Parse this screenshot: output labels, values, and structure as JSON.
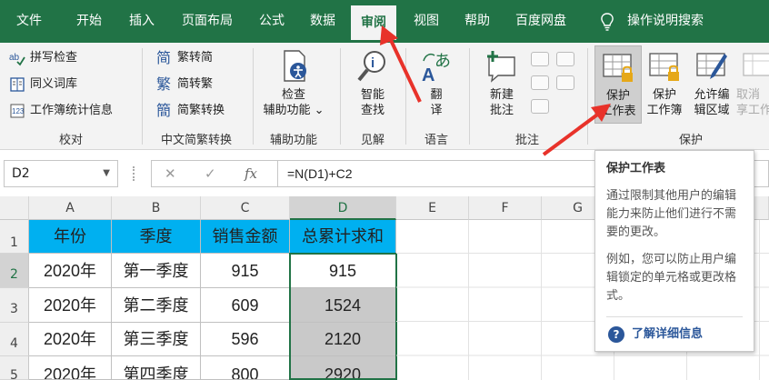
{
  "menu": {
    "tabs": [
      "文件",
      "开始",
      "插入",
      "页面布局",
      "公式",
      "数据",
      "审阅",
      "视图",
      "帮助",
      "百度网盘",
      "操作说明搜索"
    ],
    "active": "审阅"
  },
  "ribbon": {
    "proofing": {
      "items": [
        "拼写检查",
        "同义词库",
        "工作簿统计信息"
      ],
      "label": "校对"
    },
    "chinese": {
      "items": [
        "繁转简",
        "简转繁",
        "简繁转换"
      ],
      "label": "中文简繁转换"
    },
    "accessibility": {
      "button_line1": "检查",
      "button_line2": "辅助功能 ⌄",
      "label": "辅助功能"
    },
    "insights": {
      "button_line1": "智能",
      "button_line2": "查找",
      "label": "见解"
    },
    "language": {
      "button_line1": "翻",
      "button_line2": "译",
      "label": "语言"
    },
    "comments": {
      "button_line1": "新建",
      "button_line2": "批注",
      "label": "批注"
    },
    "protect": {
      "sheet_line1": "保护",
      "sheet_line2": "工作表",
      "workbook_line1": "保护",
      "workbook_line2": "工作簿",
      "ranges_line1": "允许编",
      "ranges_line2": "辑区域",
      "unshare_line1": "取消",
      "unshare_line2": "享工作",
      "label": "保护"
    }
  },
  "formula_bar": {
    "name_box": "D2",
    "formula": "=N(D1)+C2",
    "fx": "fx"
  },
  "columns": [
    "A",
    "B",
    "C",
    "D",
    "E",
    "F",
    "G"
  ],
  "rows": [
    "1",
    "2",
    "3",
    "4",
    "5"
  ],
  "table": {
    "headers": [
      "年份",
      "季度",
      "销售金额",
      "总累计求和"
    ],
    "data": [
      [
        "2020年",
        "第一季度",
        "915",
        "915"
      ],
      [
        "2020年",
        "第二季度",
        "609",
        "1524"
      ],
      [
        "2020年",
        "第三季度",
        "596",
        "2120"
      ],
      [
        "2020年",
        "第四季度",
        "800",
        "2920"
      ]
    ]
  },
  "tooltip": {
    "title": "保护工作表",
    "para1": "通过限制其他用户的编辑能力来防止他们进行不需要的更改。",
    "para2": "例如，您可以防止用户编辑锁定的单元格或更改格式。",
    "link": "了解详细信息"
  },
  "colors": {
    "excel_green": "#217346",
    "header_fill": "#00b0f0",
    "gray_fill": "#c9c9c9",
    "arrow_red": "#e8322a"
  }
}
